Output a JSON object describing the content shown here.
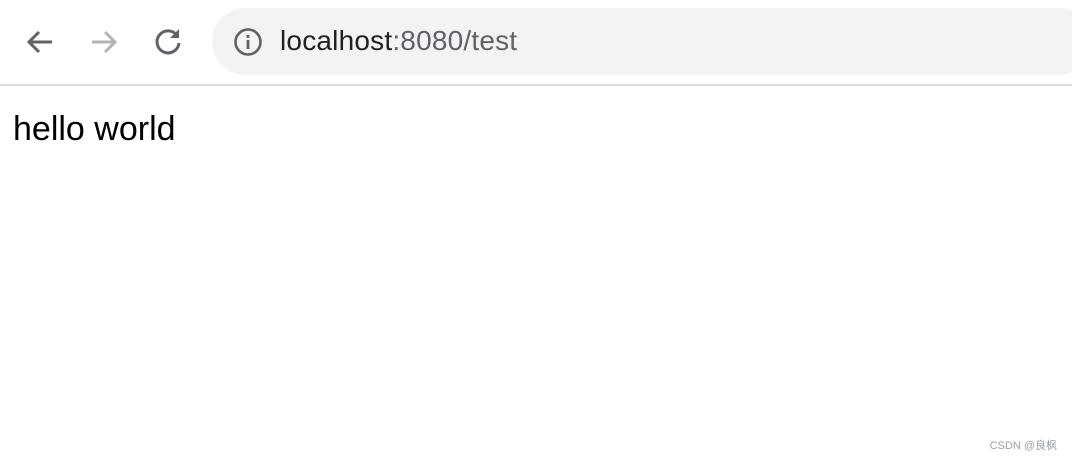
{
  "browser": {
    "nav": {
      "back_icon": "arrow-left-icon",
      "forward_icon": "arrow-right-icon",
      "reload_icon": "reload-icon"
    },
    "address_bar": {
      "site_info_icon": "info-icon",
      "host": "localhost",
      "rest": ":8080/test"
    }
  },
  "page": {
    "body_text": "hello world"
  },
  "watermark": "CSDN @良枫",
  "colors": {
    "icon_active": "#5f6368",
    "icon_disabled": "#b2b5b8",
    "omnibox_bg": "#f1f3f4",
    "divider": "#dadce0"
  }
}
